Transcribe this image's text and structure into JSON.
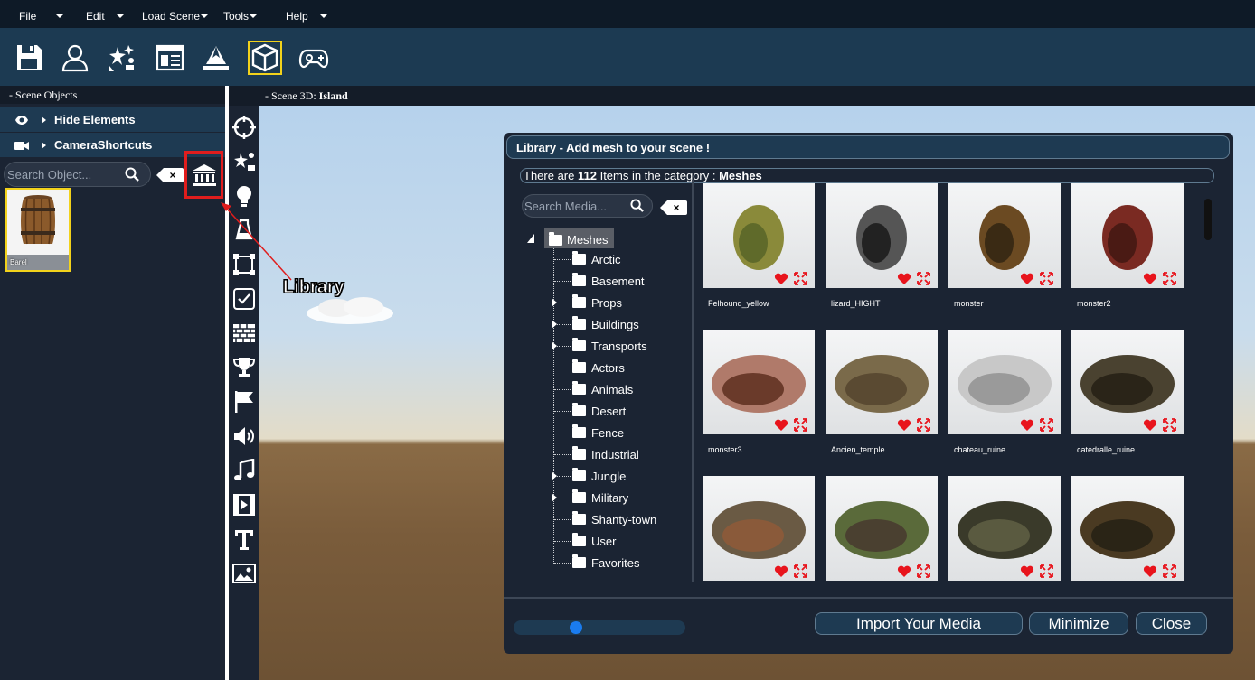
{
  "menu": {
    "items": [
      {
        "label": "File",
        "caret": true
      },
      {
        "label": "Edit",
        "caret": true
      },
      {
        "label": "Load Scene",
        "caret": true
      },
      {
        "label": "Tools",
        "caret": true
      },
      {
        "label": "Help",
        "caret": true
      }
    ]
  },
  "toolbar": {
    "icons": [
      "save-icon",
      "user-icon",
      "effects-icon",
      "layout-icon",
      "terrain-icon",
      "cube-icon",
      "gamepad-icon"
    ],
    "active": "cube-icon",
    "active_color": "#f2d21b"
  },
  "scene_objects": {
    "title": "- Scene Objects",
    "hide_elements": "Hide Elements",
    "camera_shortcuts": "CameraShortcuts",
    "search_placeholder": "Search Object...",
    "clear_label": "×",
    "assets": [
      {
        "label": "Barel"
      }
    ]
  },
  "scene3d": {
    "title_prefix": "- Scene 3D: ",
    "scene_name": "Island"
  },
  "annotation": {
    "label": "Library",
    "color": "#e01d1d"
  },
  "vertical_tools": [
    "target-icon",
    "effects-icon",
    "light-bulb-icon",
    "bottle-icon",
    "selection-icon",
    "checkbox-icon",
    "wall-icon",
    "trophy-icon",
    "flag-icon",
    "speaker-icon",
    "music-icon",
    "film-icon",
    "text-icon",
    "image-icon"
  ],
  "library": {
    "title": "Library - Add mesh to your scene !",
    "count_prefix": "There are ",
    "count": "112",
    "count_mid": " Items in the category : ",
    "category": "Meshes",
    "search_placeholder": "Search Media...",
    "clear_label": "×",
    "tree": {
      "root": "Meshes",
      "children": [
        {
          "label": "Arctic",
          "expandable": false
        },
        {
          "label": "Basement",
          "expandable": false
        },
        {
          "label": "Props",
          "expandable": true
        },
        {
          "label": "Buildings",
          "expandable": true
        },
        {
          "label": "Transports",
          "expandable": true
        },
        {
          "label": "Actors",
          "expandable": false
        },
        {
          "label": "Animals",
          "expandable": false
        },
        {
          "label": "Desert",
          "expandable": false
        },
        {
          "label": "Fence",
          "expandable": false
        },
        {
          "label": "Industrial",
          "expandable": false
        },
        {
          "label": "Jungle",
          "expandable": true
        },
        {
          "label": "Military",
          "expandable": true
        },
        {
          "label": "Shanty-town",
          "expandable": false
        },
        {
          "label": "User",
          "expandable": false
        },
        {
          "label": "Favorites",
          "expandable": false
        }
      ]
    },
    "items": [
      {
        "name": "Felhound_yellow"
      },
      {
        "name": "lizard_HIGHT"
      },
      {
        "name": "monster"
      },
      {
        "name": "monster2"
      },
      {
        "name": "monster3"
      },
      {
        "name": "Ancien_temple"
      },
      {
        "name": "chateau_ruine"
      },
      {
        "name": "catedralle_ruine"
      },
      {
        "name": ""
      },
      {
        "name": ""
      },
      {
        "name": ""
      },
      {
        "name": ""
      }
    ],
    "zoom_slider": 0.35,
    "buttons": {
      "import": "Import Your Media",
      "minimize": "Minimize",
      "close": "Close"
    },
    "heart_color": "#e8141c"
  }
}
